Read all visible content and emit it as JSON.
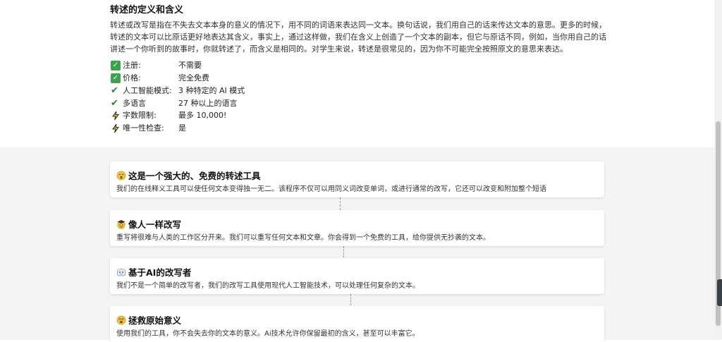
{
  "article": {
    "title": "转述的定义和含义",
    "paragraph": "转述或改写是指在不失去文本本身的意义的情况下，用不同的词语来表达同一文本。换句话说，我们用自己的话来传达文本的意思。更多的时候，转述的文本可以比原话更好地表达其含义，事实上，通过这样做，我们在含义上创造了一个文本的副本，但它与原话不同，例如，当你用自己的话讲述一个你听到的故事时，你就转述了，而含义是相同的。对学生来说，转述是很常见的，因为你不可能完全按照原文的意思来表达。"
  },
  "features": [
    {
      "icon": "check-box-icon",
      "label": "注册:",
      "value": "不需要"
    },
    {
      "icon": "check-box-icon",
      "label": "价格:",
      "value": "完全免费"
    },
    {
      "icon": "check-mark-icon",
      "label": "人工智能模式:",
      "value": "3 种特定的 AI 模式"
    },
    {
      "icon": "check-mark-icon",
      "label": "多语言",
      "value": "27 种以上的语言"
    },
    {
      "icon": "lightning-icon",
      "label": "字数限制:",
      "value": "最多 10,000!"
    },
    {
      "icon": "lightning-icon",
      "label": "唯一性检查:",
      "value": "是"
    }
  ],
  "cards": [
    {
      "icon": "astonished-face-icon",
      "title": "这是一个强大的、免费的转述工具",
      "desc": "我们的在线释义工具可以使任何文本变得独一无二。该程序不仅可以用同义词改变单词，或进行通常的改写，它还可以改变和附加整个短语"
    },
    {
      "icon": "graduate-face-icon",
      "title": "像人一样改写",
      "desc": "重写将很难与人类的工作区分开来。我们可以重写任何文本和文章。你会得到一个免费的工具，给你提供无抄袭的文本。"
    },
    {
      "icon": "robot-icon",
      "title": "基于AI的改写者",
      "desc": "我们不是一个简单的改写者，我们的改写工具使用现代人工智能技术，可以处理任何复杂的文本。"
    },
    {
      "icon": "surprised-face-icon",
      "title": "拯救原始意义",
      "desc": "使用我们的工具，你不会失去你的文本的意义。Ai技术允许你保留最初的含义，甚至可以丰富它。"
    }
  ],
  "colors": {
    "check": "#3aa44a",
    "bolt": "#222222",
    "lower_bg": "#f4f4f5"
  }
}
